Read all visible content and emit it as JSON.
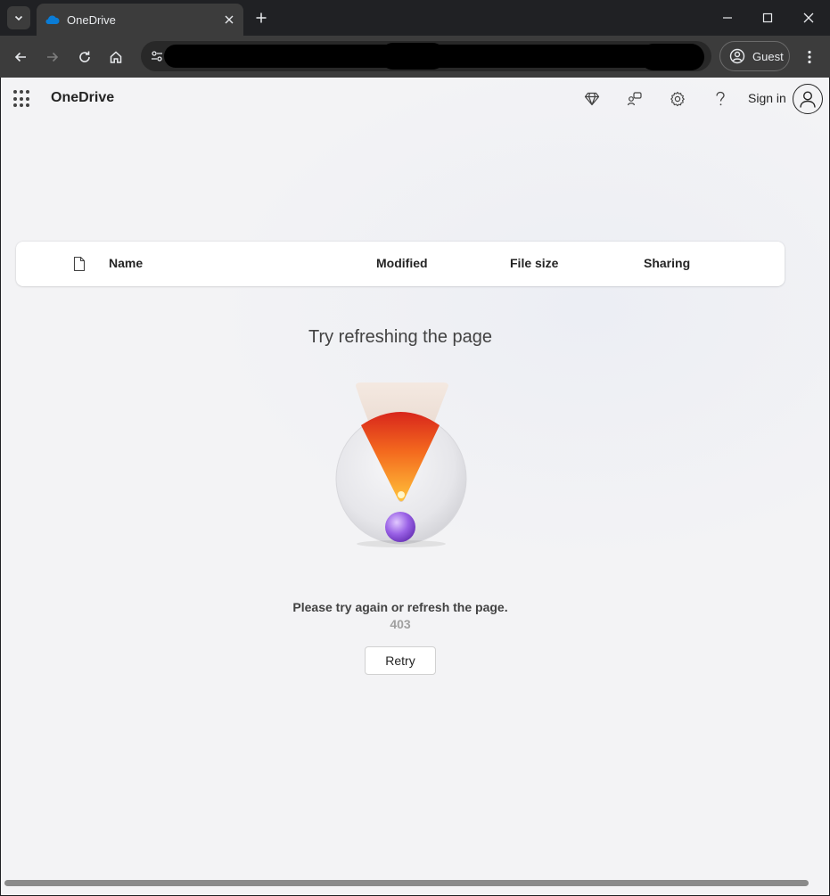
{
  "browser": {
    "tab_title": "OneDrive",
    "profile_label": "Guest"
  },
  "header": {
    "brand": "OneDrive",
    "sign_in": "Sign in"
  },
  "list": {
    "columns": [
      "Name",
      "Modified",
      "File size",
      "Sharing"
    ]
  },
  "error": {
    "title": "Try refreshing the page",
    "message": "Please try again or refresh the page.",
    "code": "403",
    "retry_label": "Retry"
  },
  "icons": [
    "tab-search-icon",
    "onedrive-cloud-icon",
    "close-icon",
    "plus-icon",
    "minimize-icon",
    "maximize-icon",
    "back-icon",
    "forward-icon",
    "reload-icon",
    "home-icon",
    "site-info-icon",
    "profile-icon",
    "more-icon",
    "app-launcher-icon",
    "premium-diamond-icon",
    "share-feedback-icon",
    "settings-gear-icon",
    "help-icon",
    "avatar-icon",
    "document-icon"
  ],
  "colors": {
    "brand_blue": "#0078d4",
    "page_bg": "#f3f3f5",
    "chrome_dark": "#202124"
  }
}
